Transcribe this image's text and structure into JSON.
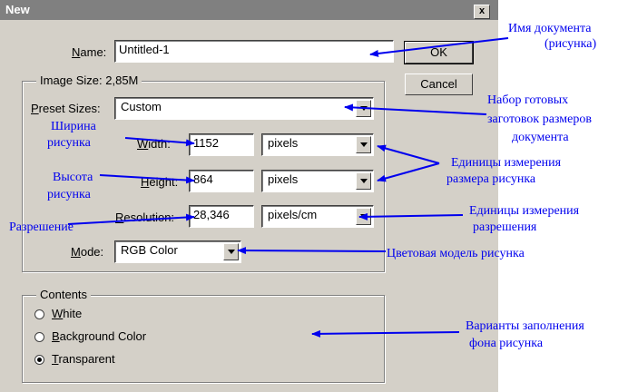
{
  "window": {
    "title": "New",
    "close": "x"
  },
  "name": {
    "label_u": "N",
    "label_rest": "ame:",
    "value": "Untitled-1"
  },
  "buttons": {
    "ok": "OK",
    "cancel": "Cancel"
  },
  "image_size": {
    "group_title": "Image Size: 2,85M",
    "preset": {
      "label_u": "P",
      "label_rest": "reset Sizes:",
      "value": "Custom"
    },
    "width": {
      "label_u": "W",
      "label_rest": "idth:",
      "value": "1152",
      "unit": "pixels"
    },
    "height": {
      "label_u": "H",
      "label_rest": "eight:",
      "value": "864",
      "unit": "pixels"
    },
    "resolution": {
      "label_u": "R",
      "label_rest": "esolution:",
      "value": "28,346",
      "unit": "pixels/cm"
    },
    "mode": {
      "label_u": "M",
      "label_rest": "ode:",
      "value": "RGB Color"
    }
  },
  "contents": {
    "group_title": "Contents",
    "options": [
      {
        "u": "W",
        "rest": "hite",
        "selected": false
      },
      {
        "u": "B",
        "rest": "ackground Color",
        "selected": false
      },
      {
        "u": "T",
        "rest": "ransparent",
        "selected": true
      }
    ]
  },
  "annotations": {
    "doc_name": [
      "Имя документа",
      "(рисунка)"
    ],
    "presets": [
      "Набор готовых",
      "заготовок размеров",
      "документа"
    ],
    "width": [
      "Ширина",
      "рисунка"
    ],
    "height": [
      "Высота",
      "рисунка"
    ],
    "size_units": [
      "Единицы измерения",
      "размера рисунка"
    ],
    "resolution": "Разрешение",
    "res_units": [
      "Единицы измерения",
      "разрешения"
    ],
    "color_model": "Цветовая модель рисунка",
    "fill": [
      "Варианты заполнения",
      "фона рисунка"
    ]
  },
  "colors": {
    "annotation": "#0000ee",
    "dialog_bg": "#d4d0c8",
    "title_bg": "#808080"
  }
}
